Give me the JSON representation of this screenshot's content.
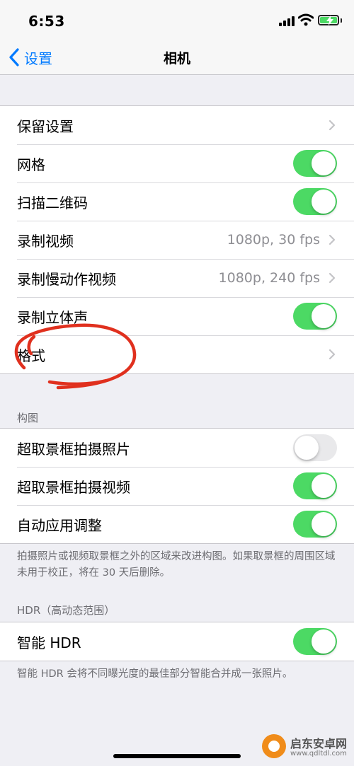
{
  "status_bar": {
    "time": "6:53"
  },
  "nav": {
    "back_label": "设置",
    "title": "相机"
  },
  "group1": {
    "items": [
      {
        "label": "保留设置"
      },
      {
        "label": "网格",
        "toggle": "on"
      },
      {
        "label": "扫描二维码",
        "toggle": "on"
      },
      {
        "label": "录制视频",
        "value": "1080p, 30 fps"
      },
      {
        "label": "录制慢动作视频",
        "value": "1080p, 240 fps"
      },
      {
        "label": "录制立体声",
        "toggle": "on"
      },
      {
        "label": "格式"
      }
    ]
  },
  "composition": {
    "header": "构图",
    "items": [
      {
        "label": "超取景框拍摄照片",
        "toggle": "off"
      },
      {
        "label": "超取景框拍摄视频",
        "toggle": "on"
      },
      {
        "label": "自动应用调整",
        "toggle": "on"
      }
    ],
    "footer": "拍摄照片或视频取景框之外的区域来改进构图。如果取景框的周围区域未用于校正，将在 30 天后删除。"
  },
  "hdr": {
    "header": "HDR（高动态范围）",
    "items": [
      {
        "label": "智能 HDR",
        "toggle": "on"
      }
    ],
    "footer": "智能 HDR 会将不同曝光度的最佳部分智能合并成一张照片。"
  },
  "watermark": {
    "title": "启东安卓网",
    "url": "www.qdltdl.com"
  },
  "colors": {
    "accent": "#007aff",
    "toggle_on": "#4cd964",
    "annotation": "#e0301e"
  },
  "icons": {
    "back": "chevron-left-icon",
    "disclosure": "chevron-right-icon",
    "wifi": "wifi-icon",
    "signal": "cellular-signal-icon",
    "battery": "battery-charging-icon"
  }
}
